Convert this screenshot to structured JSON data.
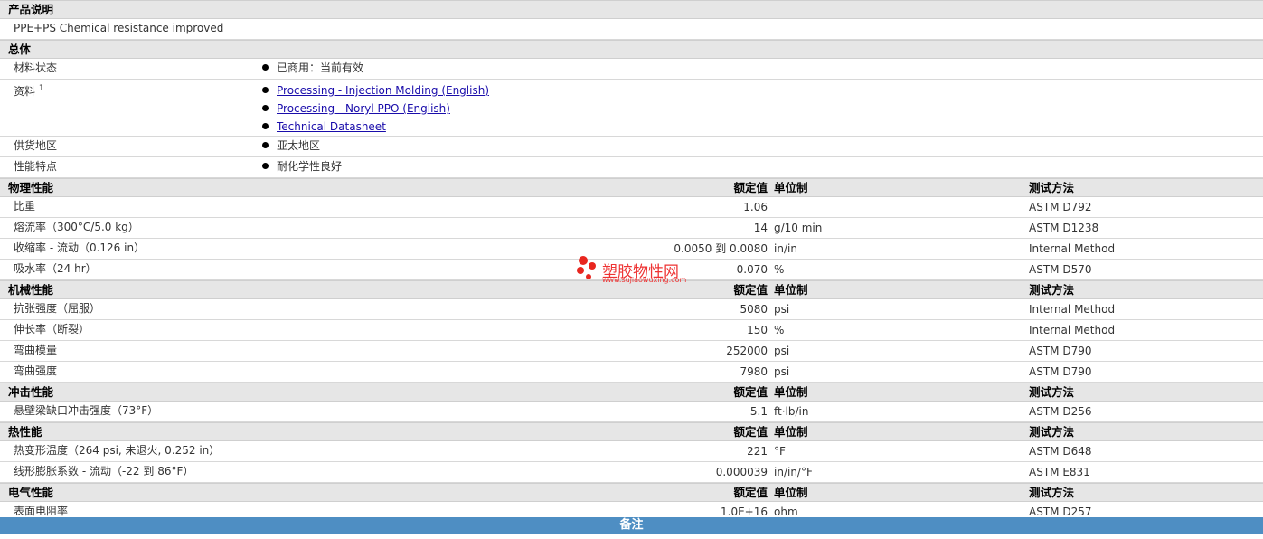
{
  "product_desc": {
    "title": "产品说明",
    "text": "PPE+PS Chemical resistance improved"
  },
  "general": {
    "title": "总体",
    "rows": {
      "material_status": {
        "label": "材料状态",
        "value": "已商用：当前有效"
      },
      "documents": {
        "label": "资料",
        "sup": "1",
        "links": [
          "Processing - Injection Molding (English)",
          "Processing - Noryl PPO (English)",
          "Technical Datasheet"
        ]
      },
      "region": {
        "label": "供货地区",
        "value": "亚太地区"
      },
      "features": {
        "label": "性能特点",
        "value": "耐化学性良好"
      }
    }
  },
  "cols": {
    "nominal": "额定值",
    "unit": "单位制",
    "test": "测试方法"
  },
  "sections": [
    {
      "title": "物理性能",
      "rows": [
        {
          "label": "比重",
          "value": "1.06",
          "unit": "",
          "test": "ASTM D792"
        },
        {
          "label": "熔流率（300°C/5.0 kg）",
          "value": "14",
          "unit": "g/10 min",
          "test": "ASTM D1238"
        },
        {
          "label": "收缩率 - 流动（0.126 in）",
          "value": "0.0050 到  0.0080",
          "unit": "in/in",
          "test": "Internal Method"
        },
        {
          "label": "吸水率（24 hr）",
          "value": "0.070",
          "unit": "%",
          "test": "ASTM D570"
        }
      ]
    },
    {
      "title": "机械性能",
      "rows": [
        {
          "label": "抗张强度（屈服）",
          "value": "5080",
          "unit": "psi",
          "test": "Internal Method"
        },
        {
          "label": "伸长率（断裂）",
          "value": "150",
          "unit": "%",
          "test": "Internal Method"
        },
        {
          "label": "弯曲模量",
          "value": "252000",
          "unit": "psi",
          "test": "ASTM D790"
        },
        {
          "label": "弯曲强度",
          "value": "7980",
          "unit": "psi",
          "test": "ASTM D790"
        }
      ]
    },
    {
      "title": "冲击性能",
      "rows": [
        {
          "label": "悬壁梁缺口冲击强度（73°F）",
          "value": "5.1",
          "unit": "ft·lb/in",
          "test": "ASTM D256"
        }
      ]
    },
    {
      "title": "热性能",
      "rows": [
        {
          "label": "热变形温度（264 psi, 未退火, 0.252 in）",
          "value": "221",
          "unit": "°F",
          "test": "ASTM D648"
        },
        {
          "label": "线形膨胀系数 - 流动（-22 到  86°F）",
          "value": "0.000039",
          "unit": "in/in/°F",
          "test": "ASTM E831"
        }
      ]
    },
    {
      "title": "电气性能",
      "rows": [
        {
          "label": "表面电阻率",
          "value": "1.0E+16",
          "unit": "ohm",
          "test": "ASTM D257"
        }
      ]
    }
  ],
  "footer": {
    "title": "备注"
  },
  "watermark": {
    "title": "塑胶物性网",
    "url": "www.sujiaowuxing.com"
  }
}
